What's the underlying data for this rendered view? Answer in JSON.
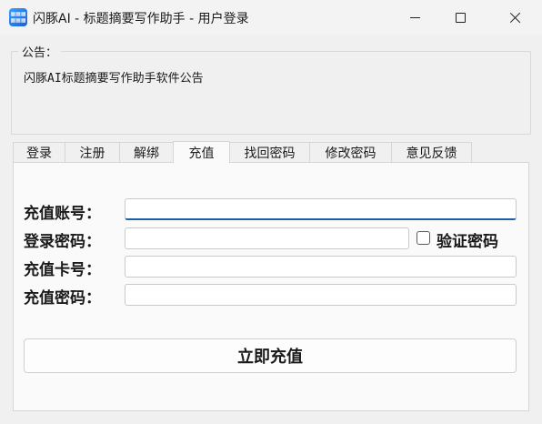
{
  "window": {
    "title": "闪豚AI - 标题摘要写作助手 - 用户登录",
    "icon_name": "app-logo-icon"
  },
  "notice": {
    "label": "公告：",
    "text": "闪豚AI标题摘要写作助手软件公告"
  },
  "tabs": [
    {
      "label": "登录",
      "active": false
    },
    {
      "label": "注册",
      "active": false
    },
    {
      "label": "解绑",
      "active": false
    },
    {
      "label": "充值",
      "active": true
    },
    {
      "label": "找回密码",
      "active": false
    },
    {
      "label": "修改密码",
      "active": false
    },
    {
      "label": "意见反馈",
      "active": false
    }
  ],
  "form": {
    "account_label": "充值账号：",
    "account_value": "",
    "password_label": "登录密码：",
    "password_value": "",
    "verify_label": "验证密码",
    "verify_checked": false,
    "card_label": "充值卡号：",
    "card_value": "",
    "card_password_label": "充值密码：",
    "card_password_value": "",
    "submit_label": "立即充值"
  },
  "colors": {
    "accent": "#1f5fa8"
  }
}
